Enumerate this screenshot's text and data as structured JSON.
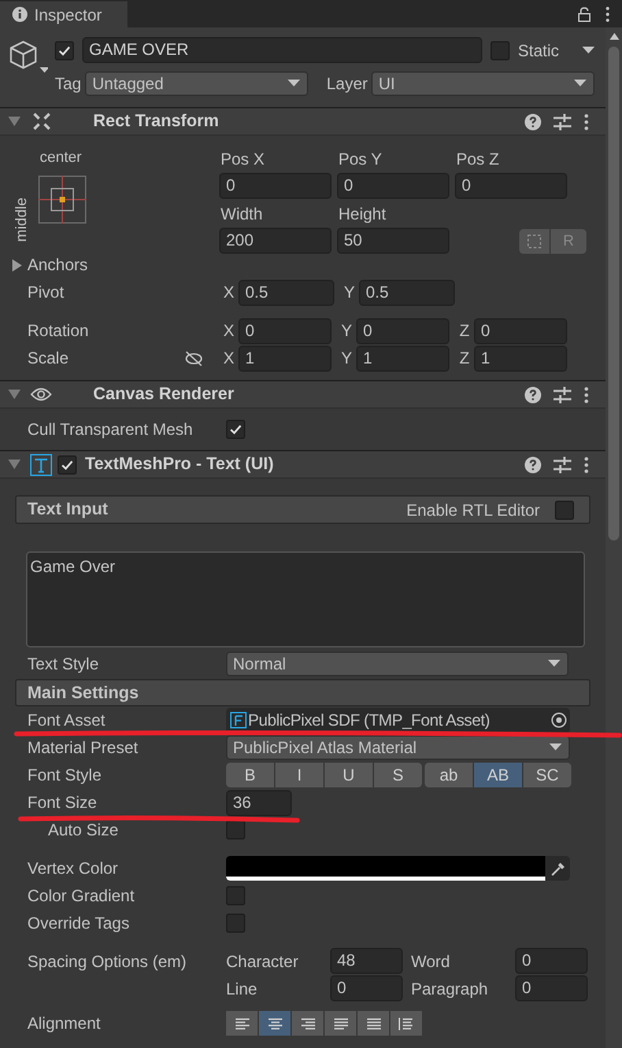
{
  "tab": {
    "title": "Inspector"
  },
  "object": {
    "active": true,
    "name": "GAME OVER",
    "static": false,
    "static_label": "Static",
    "tag_label": "Tag",
    "tag": "Untagged",
    "layer_label": "Layer",
    "layer": "UI"
  },
  "rect_transform": {
    "title": "Rect Transform",
    "expanded": true,
    "anchor_h": "center",
    "anchor_v": "middle",
    "position": [
      {
        "label": "Pos X",
        "value": "0"
      },
      {
        "label": "Pos Y",
        "value": "0"
      },
      {
        "label": "Pos Z",
        "value": "0"
      }
    ],
    "size": [
      {
        "label": "Width",
        "value": "200"
      },
      {
        "label": "Height",
        "value": "50"
      }
    ],
    "raw_button": "R",
    "anchors": {
      "label": "Anchors",
      "expanded": false
    },
    "pivot": {
      "label": "Pivot",
      "axes": [
        {
          "axis": "X",
          "value": "0.5"
        },
        {
          "axis": "Y",
          "value": "0.5"
        }
      ]
    },
    "rotation": {
      "label": "Rotation",
      "axes": [
        {
          "axis": "X",
          "value": "0"
        },
        {
          "axis": "Y",
          "value": "0"
        },
        {
          "axis": "Z",
          "value": "0"
        }
      ]
    },
    "scale": {
      "label": "Scale",
      "axes": [
        {
          "axis": "X",
          "value": "1"
        },
        {
          "axis": "Y",
          "value": "1"
        },
        {
          "axis": "Z",
          "value": "1"
        }
      ]
    }
  },
  "canvas_renderer": {
    "title": "Canvas Renderer",
    "expanded": true,
    "cull": {
      "label": "Cull Transparent Mesh",
      "checked": true
    }
  },
  "text_mesh_pro": {
    "title": "TextMeshPro - Text (UI)",
    "enabled": true,
    "expanded": true,
    "text_input": {
      "label": "Text Input",
      "rtl_label": "Enable RTL Editor",
      "rtl": false
    },
    "text": "Game Over",
    "text_style": {
      "label": "Text Style",
      "value": "Normal"
    },
    "main_settings": "Main Settings",
    "font_asset": {
      "label": "Font Asset",
      "value": "PublicPixel SDF (TMP_Font Asset)"
    },
    "material_preset": {
      "label": "Material Preset",
      "value": "PublicPixel Atlas Material"
    },
    "font_style": {
      "label": "Font Style",
      "groups": [
        [
          {
            "label": "B",
            "selected": false
          },
          {
            "label": "I",
            "selected": false
          },
          {
            "label": "U",
            "selected": false
          },
          {
            "label": "S",
            "selected": false
          }
        ],
        [
          {
            "label": "ab",
            "selected": false
          },
          {
            "label": "AB",
            "selected": true
          },
          {
            "label": "SC",
            "selected": false
          }
        ]
      ]
    },
    "font_size": {
      "label": "Font Size",
      "value": "36"
    },
    "auto_size": {
      "label": "Auto Size",
      "checked": false
    },
    "vertex_color": {
      "label": "Vertex Color",
      "color": "#000000"
    },
    "color_gradient": {
      "label": "Color Gradient",
      "checked": false
    },
    "override_tags": {
      "label": "Override Tags",
      "checked": false
    },
    "spacing": {
      "label": "Spacing Options (em)",
      "fields": [
        {
          "label": "Character",
          "value": "48"
        },
        {
          "label": "Word",
          "value": "0"
        },
        {
          "label": "Line",
          "value": "0"
        },
        {
          "label": "Paragraph",
          "value": "0"
        }
      ]
    },
    "alignment": {
      "label": "Alignment",
      "buttons": [
        {
          "kind": "left",
          "selected": false
        },
        {
          "kind": "center",
          "selected": true
        },
        {
          "kind": "right",
          "selected": false
        },
        {
          "kind": "justified",
          "selected": false
        },
        {
          "kind": "flush",
          "selected": false
        },
        {
          "kind": "geometry",
          "selected": false
        }
      ]
    }
  }
}
